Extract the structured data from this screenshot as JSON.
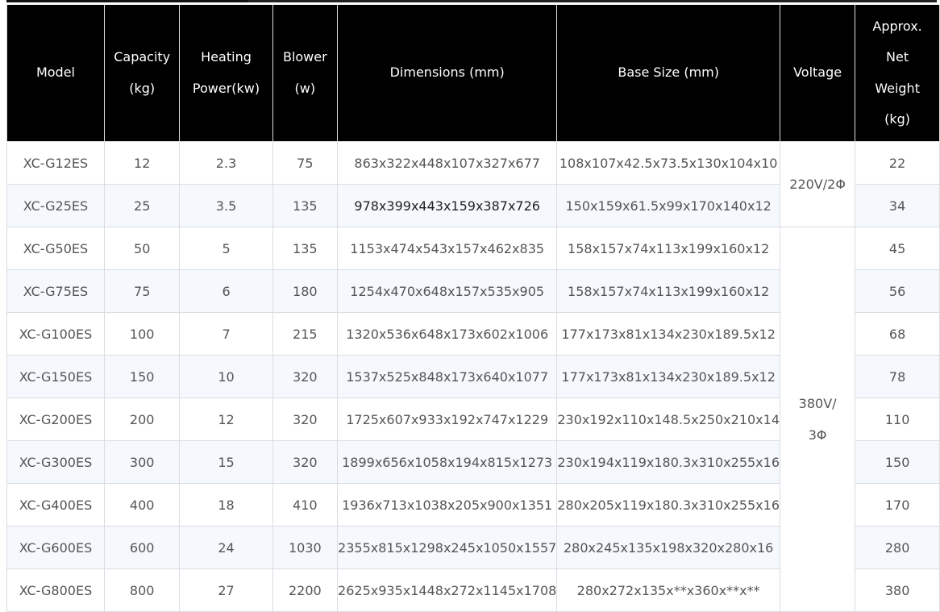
{
  "headers": [
    [
      "Model"
    ],
    [
      "Capacity",
      "(kg)"
    ],
    [
      "Heating",
      "Power(kw)"
    ],
    [
      "Blower",
      "(w)"
    ],
    [
      "Dimensions (mm)"
    ],
    [
      "Base Size (mm)"
    ],
    [
      "Voltage"
    ],
    [
      "Approx.",
      "Net",
      "Weight",
      "(kg)"
    ]
  ],
  "voltage_groups": [
    {
      "lines": [
        "220V/2Φ"
      ]
    },
    {
      "lines": [
        "380V/",
        "3Φ"
      ]
    }
  ],
  "rows": [
    {
      "model": "XC-G12ES",
      "capacity": "12",
      "heating": "2.3",
      "blower": "75",
      "dimensions": "863x322x448x107x327x677",
      "base": "108x107x42.5x73.5x130x104x10",
      "weight": "22"
    },
    {
      "model": "XC-G25ES",
      "capacity": "25",
      "heating": "3.5",
      "blower": "135",
      "dimensions": "978x399x443x159x387x726",
      "base": "150x159x61.5x99x170x140x12",
      "weight": "34"
    },
    {
      "model": "XC-G50ES",
      "capacity": "50",
      "heating": "5",
      "blower": "135",
      "dimensions": "1153x474x543x157x462x835",
      "base": "158x157x74x113x199x160x12",
      "weight": "45"
    },
    {
      "model": "XC-G75ES",
      "capacity": "75",
      "heating": "6",
      "blower": "180",
      "dimensions": "1254x470x648x157x535x905",
      "base": "158x157x74x113x199x160x12",
      "weight": "56"
    },
    {
      "model": "XC-G100ES",
      "capacity": "100",
      "heating": "7",
      "blower": "215",
      "dimensions": "1320x536x648x173x602x1006",
      "base": "177x173x81x134x230x189.5x12",
      "weight": "68"
    },
    {
      "model": "XC-G150ES",
      "capacity": "150",
      "heating": "10",
      "blower": "320",
      "dimensions": "1537x525x848x173x640x1077",
      "base": "177x173x81x134x230x189.5x12",
      "weight": "78"
    },
    {
      "model": "XC-G200ES",
      "capacity": "200",
      "heating": "12",
      "blower": "320",
      "dimensions": "1725x607x933x192x747x1229",
      "base": "230x192x110x148.5x250x210x14",
      "weight": "110"
    },
    {
      "model": "XC-G300ES",
      "capacity": "300",
      "heating": "15",
      "blower": "320",
      "dimensions": "1899x656x1058x194x815x1273",
      "base": "230x194x119x180.3x310x255x16",
      "weight": "150"
    },
    {
      "model": "XC-G400ES",
      "capacity": "400",
      "heating": "18",
      "blower": "410",
      "dimensions": "1936x713x1038x205x900x1351",
      "base": "280x205x119x180.3x310x255x16",
      "weight": "170"
    },
    {
      "model": "XC-G600ES",
      "capacity": "600",
      "heating": "24",
      "blower": "1030",
      "dimensions": "2355x815x1298x245x1050x1557",
      "base": "280x245x135x198x320x280x16",
      "weight": "280"
    },
    {
      "model": "XC-G800ES",
      "capacity": "800",
      "heating": "27",
      "blower": "2200",
      "dimensions": "2625x935x1448x272x1145x1708",
      "base": "280x272x135x**x360x**x**",
      "weight": "380"
    }
  ]
}
